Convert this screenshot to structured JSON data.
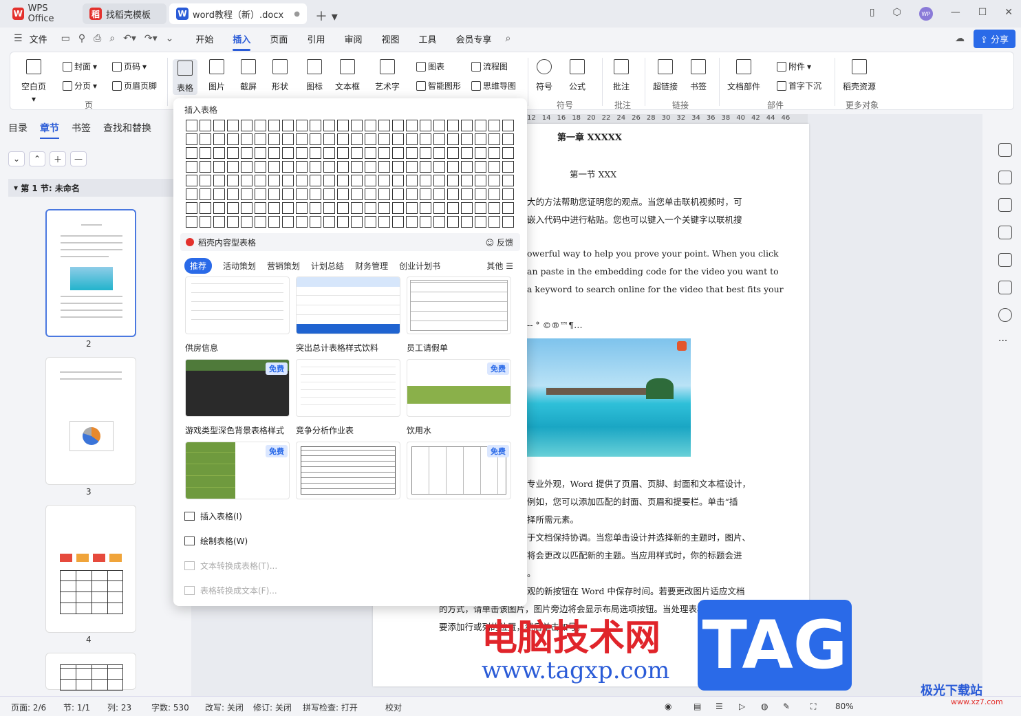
{
  "titlebar": {
    "tabs": [
      {
        "label": "WPS Office"
      },
      {
        "label": "找稻壳模板"
      },
      {
        "label": "word教程（新）.docx"
      }
    ],
    "avatar": "WP"
  },
  "menubar": {
    "file": "文件",
    "items": [
      "开始",
      "插入",
      "页面",
      "引用",
      "审阅",
      "视图",
      "工具",
      "会员专享"
    ],
    "active": "插入",
    "share": "分享"
  },
  "ribbon": {
    "blank_page": "空白页",
    "cover": "封面",
    "page_break": "分页",
    "page_num": "页码",
    "header_footer": "页眉页脚",
    "group_page": "页",
    "table": "表格",
    "picture": "图片",
    "screenshot": "截屏",
    "shape": "形状",
    "icon": "图标",
    "textbox": "文本框",
    "wordart": "艺术字",
    "chart": "图表",
    "smartart": "智能图形",
    "flowchart": "流程图",
    "mindmap": "思维导图",
    "symbol": "符号",
    "formula": "公式",
    "group_symbol": "符号",
    "comment": "批注",
    "group_comment": "批注",
    "hyperlink": "超链接",
    "bookmark": "书签",
    "group_link": "链接",
    "docpart": "文档部件",
    "attachment": "附件",
    "dropcap": "首字下沉",
    "group_part": "部件",
    "resources": "稻壳资源",
    "group_more": "更多对象"
  },
  "leftpanel": {
    "tabs": [
      "目录",
      "章节",
      "书签",
      "查找和替换"
    ],
    "active_tab": "章节",
    "section": "第 1 节: 未命名",
    "pages": [
      "2",
      "3",
      "4"
    ]
  },
  "dropdown": {
    "title": "插入表格",
    "sub_title": "稻壳内容型表格",
    "feedback": "反馈",
    "categories": [
      "推荐",
      "活动策划",
      "营销策划",
      "计划总结",
      "财务管理",
      "创业计划书"
    ],
    "more": "其他",
    "free": "免费",
    "templates": [
      {
        "label": "供房信息"
      },
      {
        "label": "突出总计表格样式饮料"
      },
      {
        "label": "员工请假单"
      },
      {
        "label": "游戏类型深色背景表格样式"
      },
      {
        "label": "竞争分析作业表"
      },
      {
        "label": "饮用水"
      }
    ],
    "actions": [
      {
        "label": "插入表格(I)"
      },
      {
        "label": "绘制表格(W)"
      },
      {
        "label": "文本转换成表格(T)..."
      },
      {
        "label": "表格转换成文本(F)..."
      }
    ]
  },
  "document": {
    "heading1": "第一章  XXXXX",
    "heading2": "第一节  XXX",
    "lines": [
      "大的方法帮助您证明您的观点。当您单击联机视频时，可",
      "嵌入代码中进行粘贴。您也可以键入一个关键字以联机搜",
      "owerful way to help you prove your point. When you click",
      "an paste in the embedding code for the video you want to",
      "a keyword to search online for the video that best fits your",
      "--    °  ©®™¶…",
      "专业外观，Word 提供了页眉、页脚、封面和文本框设计，",
      "例如，您可以添加匹配的封面、页眉和提要栏。单击“插",
      "择所需元素。",
      "于文档保持协调。当您单击设计并选择新的主题时，图片、",
      "将会更改以匹配新的主题。当应用样式时，你的标题会进",
      "。",
      "观的新按钮在 Word 中保存时间。若要更改图片适应文档",
      "的方式，请单击该图片，图片旁边将会显示布局选项按钮。当处理表格时，单击",
      "要添加行或列的位置，然后单击加号。"
    ],
    "ruler": [
      "12",
      "14",
      "16",
      "18",
      "20",
      "22",
      "24",
      "26",
      "28",
      "30",
      "32",
      "34",
      "36",
      "38",
      "40",
      "42",
      "44",
      "46"
    ]
  },
  "status": {
    "page": "页面: 2/6",
    "section": "节: 1/1",
    "col": "列: 23",
    "words": "字数: 530",
    "rewrite": "改写: 关闭",
    "revise": "修订: 关闭",
    "spell": "拼写检查: 打开",
    "proof": "校对",
    "zoom": "80%"
  },
  "watermark": {
    "site": "电脑技术网",
    "url": "www.tagxp.com",
    "tag": "TAG",
    "brand": "极光下载站",
    "brand_url": "www.xz7.com"
  },
  "colors": {
    "accent": "#2a5bd7",
    "brand_red": "#e3312d"
  }
}
